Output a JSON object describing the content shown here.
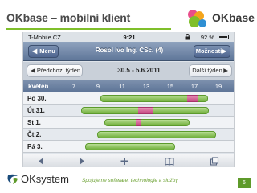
{
  "slide": {
    "title": "OKbase – mobilní klient",
    "logo_text": "OKbase",
    "footer_brand": "OKsystem",
    "footer_tagline": "Spojujeme software, technologie a služby",
    "page_number": "6",
    "accent_color": "#7fbf2a"
  },
  "statusbar": {
    "carrier": "T-Mobile CZ",
    "time": "9:21",
    "battery": "92 %"
  },
  "navbar": {
    "back_label": "Menu",
    "title": "Rosol Ivo Ing. CSc. (4)",
    "forward_label": "Možnosti"
  },
  "weekbar": {
    "prev_label": "Předchozí týden",
    "range": "30.5 - 5.6.2011",
    "next_label": "Další týden"
  },
  "timeline": {
    "month": "květen",
    "hours": [
      "7",
      "9",
      "11",
      "13",
      "15",
      "17",
      "19"
    ],
    "hour_start": 6,
    "hour_end": 20
  },
  "days": [
    {
      "label": "Po 30.",
      "green": [
        [
          9.2,
          18.1
        ]
      ],
      "pink": [
        [
          16.4,
          17.3
        ]
      ]
    },
    {
      "label": "Út 31.",
      "green": [
        [
          7.6,
          18.2
        ]
      ],
      "pink": [
        [
          12.3,
          13.5
        ]
      ]
    },
    {
      "label": "St 1.",
      "green": [
        [
          9.5,
          16.6
        ]
      ],
      "pink": [
        [
          12.1,
          12.6
        ]
      ]
    },
    {
      "label": "Čt 2.",
      "green": [
        [
          8.9,
          18.8
        ]
      ],
      "pink": []
    },
    {
      "label": "Pá 3.",
      "green": [
        [
          7.9,
          15.4
        ]
      ],
      "pink": []
    }
  ],
  "toolbar": {
    "icons": [
      "arrow-left-icon",
      "arrow-right-icon",
      "add-icon",
      "bookmarks-icon",
      "pages-icon"
    ]
  }
}
